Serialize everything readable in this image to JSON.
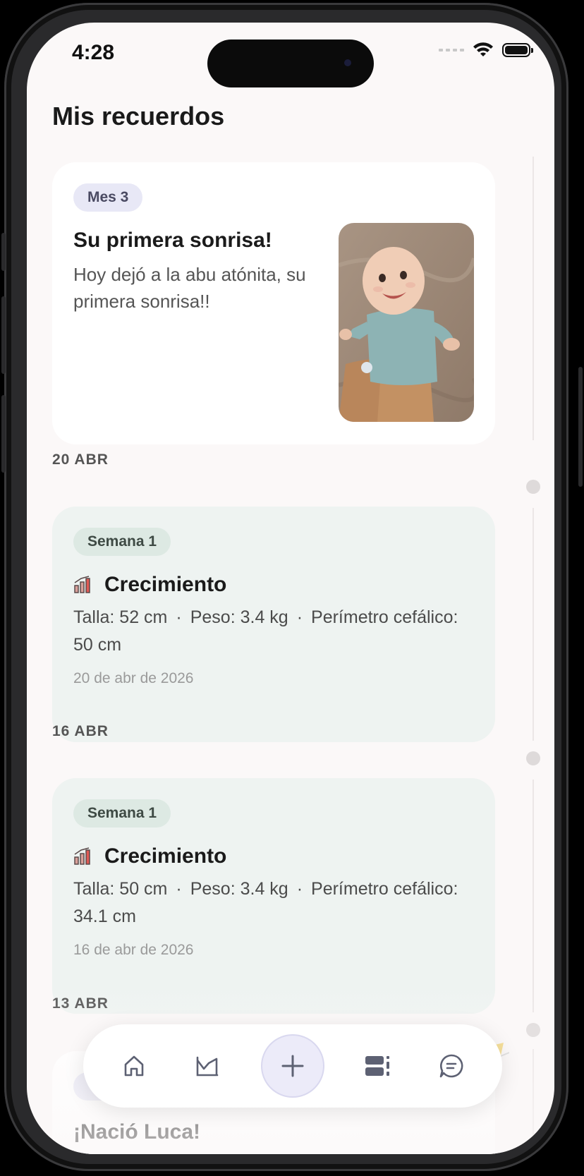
{
  "status": {
    "time": "4:28"
  },
  "header": {
    "title": "Mis recuerdos"
  },
  "featured": {
    "badge": "Mes 3",
    "title": "Su primera sonrisa!",
    "text": "Hoy dejó a la abu atónita, su primera sonrisa!!"
  },
  "entries": [
    {
      "date_label": "20 ABR",
      "badge": "Semana 1",
      "title": "Crecimiento",
      "talla": "Talla: 52 cm",
      "peso": "Peso: 3.4 kg",
      "perimetro": "Perímetro cefálico: 50 cm",
      "date": "20 de abr de 2026"
    },
    {
      "date_label": "16 ABR",
      "badge": "Semana 1",
      "title": "Crecimiento",
      "talla": "Talla: 50 cm",
      "peso": "Peso: 3.4 kg",
      "perimetro": "Perímetro cefálico: 34.1 cm",
      "date": "16 de abr de 2026"
    }
  ],
  "next_entry": {
    "date_label": "13 ABR",
    "title": "¡Nació Luca!"
  },
  "icons": {
    "home": "home-icon",
    "chart": "growth-chart-icon",
    "add": "plus-icon",
    "album": "album-icon",
    "chat": "chat-icon",
    "growth": "growth-bars-icon"
  },
  "colors": {
    "background": "#fbf8f8",
    "card": "#ffffff",
    "growth_card": "#eef3f1",
    "month_badge": "#e8e8f6",
    "week_badge": "#dde9e3",
    "add_button": "#ecebf9",
    "icon": "#5d6173"
  }
}
